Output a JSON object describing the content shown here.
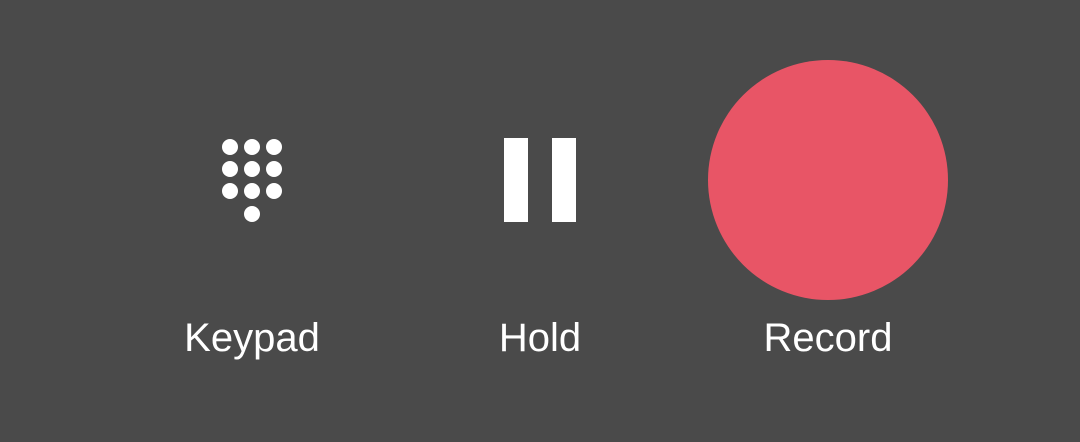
{
  "controls": {
    "keypad": {
      "label": "Keypad",
      "icon": "dialpad-icon"
    },
    "hold": {
      "label": "Hold",
      "icon": "pause-icon"
    },
    "record": {
      "label": "Record",
      "icon": "record-circle-icon"
    }
  },
  "colors": {
    "background": "#4a4a4a",
    "icon": "#ffffff",
    "record_accent": "#e85566"
  }
}
